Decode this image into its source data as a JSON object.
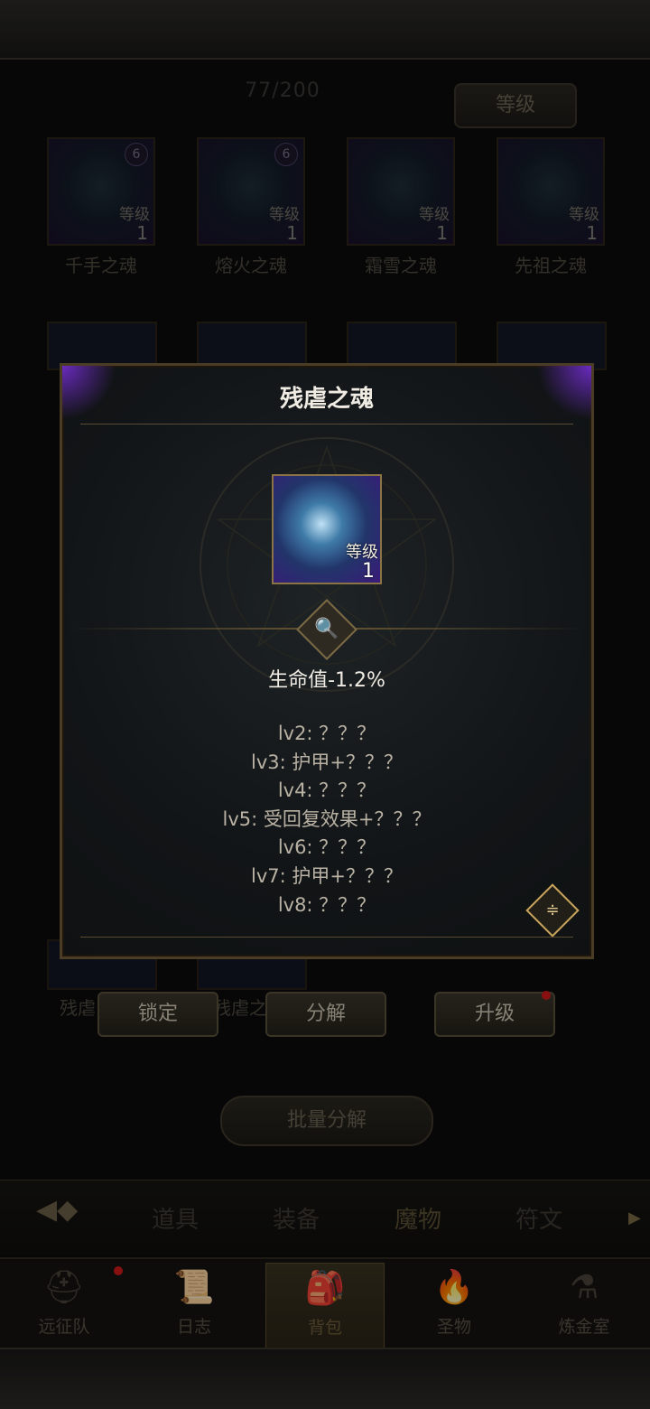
{
  "header": {
    "counter": "77/200",
    "sort_label": "等级"
  },
  "grid": [
    {
      "name": "千手之魂",
      "badge": "6",
      "lvl_label": "等级",
      "lvl": "1"
    },
    {
      "name": "熔火之魂",
      "badge": "6",
      "lvl_label": "等级",
      "lvl": "1"
    },
    {
      "name": "霜雪之魂",
      "badge": "",
      "lvl_label": "等级",
      "lvl": "1"
    },
    {
      "name": "先祖之魂",
      "badge": "",
      "lvl_label": "等级",
      "lvl": "1"
    }
  ],
  "partial_names": {
    "left": "残虐",
    "mid": "残虐之"
  },
  "actions": {
    "lock": "锁定",
    "decompose": "分解",
    "upgrade": "升级"
  },
  "bulk_label": "批量分解",
  "tabs": {
    "items": "道具",
    "equipment": "装备",
    "monsters": "魔物",
    "runes": "符文"
  },
  "nav": [
    {
      "label": "远征队",
      "icon": "viking-helmet-icon"
    },
    {
      "label": "日志",
      "icon": "scroll-icon"
    },
    {
      "label": "背包",
      "icon": "backpack-icon"
    },
    {
      "label": "圣物",
      "icon": "torch-icon"
    },
    {
      "label": "炼金室",
      "icon": "alchemy-icon"
    }
  ],
  "modal": {
    "title": "残虐之魂",
    "lvl_label": "等级",
    "lvl": "1",
    "effect": "生命值-1.2%",
    "levels": [
      "lv2: ？？？",
      "lv3: 护甲+？？？",
      "lv4: ？？？",
      "lv5: 受回复效果+？？？",
      "lv6: ？？？",
      "lv7: 护甲+？？？",
      "lv8: ？？？"
    ]
  },
  "colors": {
    "accent_gold": "#c9a45b",
    "rarity_purple": "#3a1a7a",
    "alert_red": "#d21a1a"
  }
}
